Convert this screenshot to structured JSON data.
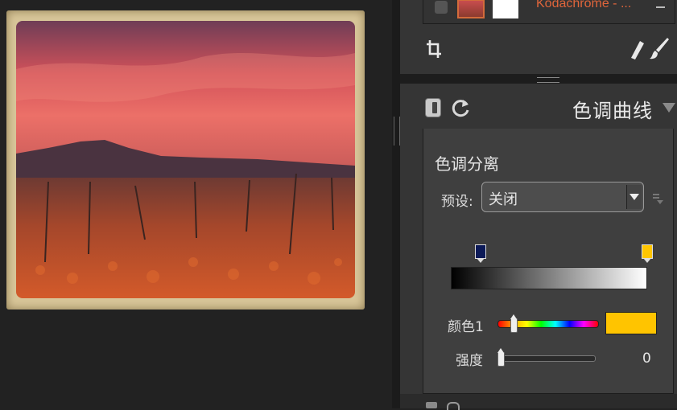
{
  "layer": {
    "name": "Kodachrome - ..."
  },
  "tools": {
    "crop": "crop-icon",
    "eraser": "eraser-icon",
    "brush": "brush-icon"
  },
  "filter": {
    "title": "色调曲线",
    "section_title": "色调分离",
    "preset_label": "预设:",
    "preset_value": "关闭",
    "color_label": "颜色1",
    "strength_label": "强度",
    "strength_value": "0",
    "hue_level": 0.16,
    "strength_level": 0.0,
    "shadow_stop_color": "#0c1a58",
    "highlight_stop_color": "#ffc600",
    "color_swatch": "#ffc400"
  },
  "colors": {
    "accent_orange": "#e0653b",
    "panel_bg": "#353535",
    "canvas_bg": "#222222"
  }
}
